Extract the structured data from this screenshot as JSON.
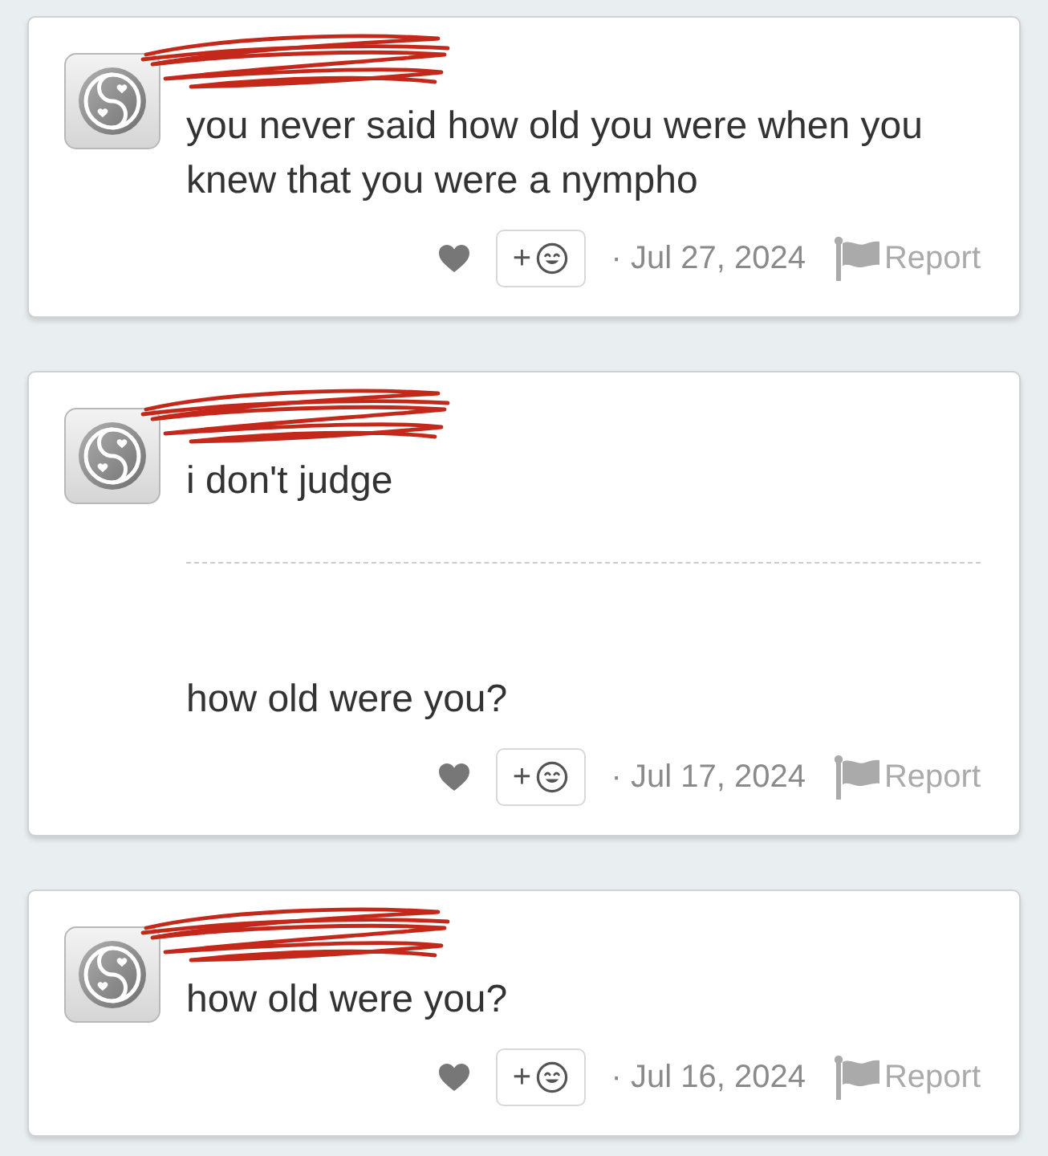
{
  "comments": [
    {
      "author_redacted": true,
      "paragraphs": [
        "you never said how old you were when you knew that you were a nympho"
      ],
      "reaction_label": "+",
      "date": "· Jul 27, 2024",
      "report_label": "Report"
    },
    {
      "author_redacted": true,
      "paragraphs": [
        "i don't judge",
        "how old were you?"
      ],
      "reaction_label": "+",
      "date": "· Jul 17, 2024",
      "report_label": "Report"
    },
    {
      "author_redacted": true,
      "paragraphs": [
        "how old were you?"
      ],
      "reaction_label": "+",
      "date": "· Jul 16, 2024",
      "report_label": "Report"
    }
  ]
}
